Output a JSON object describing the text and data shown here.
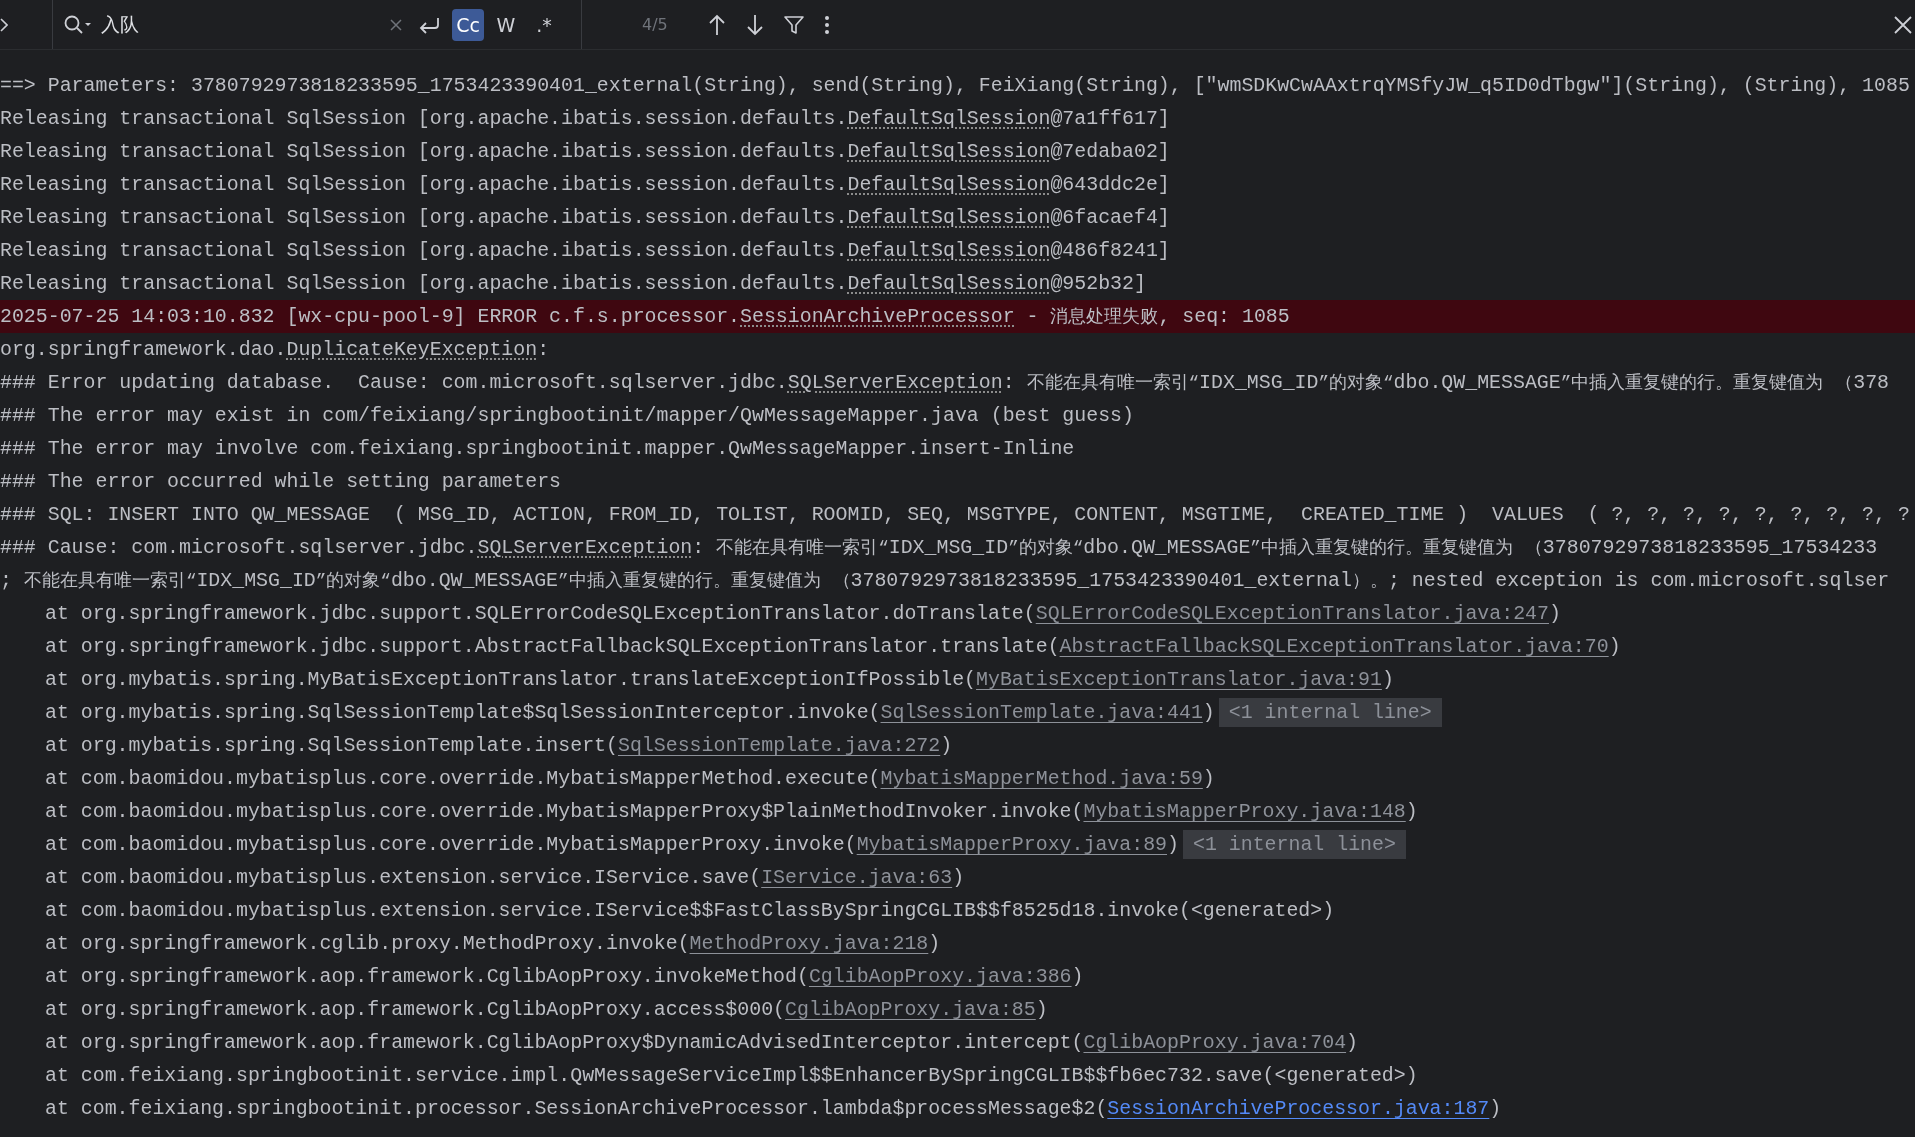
{
  "search": {
    "value": "入队",
    "options": [
      {
        "label": "Cc",
        "selected": true
      },
      {
        "label": "W",
        "selected": false
      },
      {
        "label": ".*",
        "selected": false
      }
    ],
    "match_count": "4/5"
  },
  "lines": [
    {
      "kind": "normal",
      "segments": [
        {
          "kind": "plain",
          "text": "==> Parameters: 3780792973818233595_1753423390401_external(String), send(String), FeiXiang(String), [\"wmSDKwCwAAxtrqYMSfyJW_q5ID0dTbgw\"](String), (String), 1085"
        }
      ]
    },
    {
      "kind": "normal",
      "segments": [
        {
          "kind": "plain",
          "text": "Releasing transactional SqlSession [org.apache.ibatis.session.defaults."
        },
        {
          "kind": "ref",
          "text": "DefaultSqlSession"
        },
        {
          "kind": "plain",
          "text": "@7a1ff617]"
        }
      ]
    },
    {
      "kind": "normal",
      "segments": [
        {
          "kind": "plain",
          "text": "Releasing transactional SqlSession [org.apache.ibatis.session.defaults."
        },
        {
          "kind": "ref",
          "text": "DefaultSqlSession"
        },
        {
          "kind": "plain",
          "text": "@7edaba02]"
        }
      ]
    },
    {
      "kind": "normal",
      "segments": [
        {
          "kind": "plain",
          "text": "Releasing transactional SqlSession [org.apache.ibatis.session.defaults."
        },
        {
          "kind": "ref",
          "text": "DefaultSqlSession"
        },
        {
          "kind": "plain",
          "text": "@643ddc2e]"
        }
      ]
    },
    {
      "kind": "normal",
      "segments": [
        {
          "kind": "plain",
          "text": "Releasing transactional SqlSession [org.apache.ibatis.session.defaults."
        },
        {
          "kind": "ref",
          "text": "DefaultSqlSession"
        },
        {
          "kind": "plain",
          "text": "@6facaef4]"
        }
      ]
    },
    {
      "kind": "normal",
      "segments": [
        {
          "kind": "plain",
          "text": "Releasing transactional SqlSession [org.apache.ibatis.session.defaults."
        },
        {
          "kind": "ref",
          "text": "DefaultSqlSession"
        },
        {
          "kind": "plain",
          "text": "@486f8241]"
        }
      ]
    },
    {
      "kind": "normal",
      "segments": [
        {
          "kind": "plain",
          "text": "Releasing transactional SqlSession [org.apache.ibatis.session.defaults."
        },
        {
          "kind": "ref",
          "text": "DefaultSqlSession"
        },
        {
          "kind": "plain",
          "text": "@952b32]"
        }
      ]
    },
    {
      "kind": "error",
      "segments": [
        {
          "kind": "plain",
          "text": "2025-07-25 14:03:10.832 [wx-cpu-pool-9] ERROR c.f.s.processor."
        },
        {
          "kind": "ref",
          "text": "SessionArchiveProcessor"
        },
        {
          "kind": "plain",
          "text": " - 消息处理失败, seq: 1085"
        }
      ]
    },
    {
      "kind": "normal",
      "segments": [
        {
          "kind": "plain",
          "text": "org.springframework.dao."
        },
        {
          "kind": "ref",
          "text": "DuplicateKeyException"
        },
        {
          "kind": "plain",
          "text": ":"
        }
      ]
    },
    {
      "kind": "normal",
      "segments": [
        {
          "kind": "plain",
          "text": "### Error updating database.  Cause: com.microsoft.sqlserver.jdbc."
        },
        {
          "kind": "ref",
          "text": "SQLServerException"
        },
        {
          "kind": "plain",
          "text": ": 不能在具有唯一索引“IDX_MSG_ID”的对象“dbo.QW_MESSAGE”中插入重复键的行。重复键值为 （378"
        }
      ]
    },
    {
      "kind": "normal",
      "segments": [
        {
          "kind": "plain",
          "text": "### The error may exist in com/feixiang/springbootinit/mapper/QwMessageMapper.java (best guess)"
        }
      ]
    },
    {
      "kind": "normal",
      "segments": [
        {
          "kind": "plain",
          "text": "### The error may involve com.feixiang.springbootinit.mapper.QwMessageMapper.insert-Inline"
        }
      ]
    },
    {
      "kind": "normal",
      "segments": [
        {
          "kind": "plain",
          "text": "### The error occurred while setting parameters"
        }
      ]
    },
    {
      "kind": "normal",
      "segments": [
        {
          "kind": "plain",
          "text": "### SQL: INSERT INTO QW_MESSAGE  ( MSG_ID, ACTION, FROM_ID, TOLIST, ROOMID, SEQ, MSGTYPE, CONTENT, MSGTIME,  CREATED_TIME )  VALUES  ( ?, ?, ?, ?, ?, ?, ?, ?, ?"
        }
      ]
    },
    {
      "kind": "normal",
      "segments": [
        {
          "kind": "plain",
          "text": "### Cause: com.microsoft.sqlserver.jdbc."
        },
        {
          "kind": "ref",
          "text": "SQLServerException"
        },
        {
          "kind": "plain",
          "text": ": 不能在具有唯一索引“IDX_MSG_ID”的对象“dbo.QW_MESSAGE”中插入重复键的行。重复键值为 （3780792973818233595_17534233"
        }
      ]
    },
    {
      "kind": "normal",
      "segments": [
        {
          "kind": "plain",
          "text": "; 不能在具有唯一索引“IDX_MSG_ID”的对象“dbo.QW_MESSAGE”中插入重复键的行。重复键值为 （3780792973818233595_1753423390401_external）。; nested exception is com.microsoft.sqlser"
        }
      ]
    },
    {
      "kind": "frame",
      "segments": [
        {
          "kind": "plain",
          "text": "at org.springframework.jdbc.support.SQLErrorCodeSQLExceptionTranslator.doTranslate("
        },
        {
          "kind": "link",
          "text": "SQLErrorCodeSQLExceptionTranslator.java:247"
        },
        {
          "kind": "plain",
          "text": ")"
        }
      ]
    },
    {
      "kind": "frame",
      "segments": [
        {
          "kind": "plain",
          "text": "at org.springframework.jdbc.support.AbstractFallbackSQLExceptionTranslator.translate("
        },
        {
          "kind": "link",
          "text": "AbstractFallbackSQLExceptionTranslator.java:70"
        },
        {
          "kind": "plain",
          "text": ")"
        }
      ]
    },
    {
      "kind": "frame",
      "segments": [
        {
          "kind": "plain",
          "text": "at org.mybatis.spring.MyBatisExceptionTranslator.translateExceptionIfPossible("
        },
        {
          "kind": "link",
          "text": "MyBatisExceptionTranslator.java:91"
        },
        {
          "kind": "plain",
          "text": ")"
        }
      ]
    },
    {
      "kind": "frame",
      "segments": [
        {
          "kind": "plain",
          "text": "at org.mybatis.spring.SqlSessionTemplate$SqlSessionInterceptor.invoke("
        },
        {
          "kind": "link",
          "text": "SqlSessionTemplate.java:441"
        },
        {
          "kind": "plain",
          "text": ")"
        },
        {
          "kind": "fold",
          "text": "<1 internal line>"
        }
      ]
    },
    {
      "kind": "frame",
      "segments": [
        {
          "kind": "plain",
          "text": "at org.mybatis.spring.SqlSessionTemplate.insert("
        },
        {
          "kind": "link",
          "text": "SqlSessionTemplate.java:272"
        },
        {
          "kind": "plain",
          "text": ")"
        }
      ]
    },
    {
      "kind": "frame",
      "segments": [
        {
          "kind": "plain",
          "text": "at com.baomidou.mybatisplus.core.override.MybatisMapperMethod.execute("
        },
        {
          "kind": "link",
          "text": "MybatisMapperMethod.java:59"
        },
        {
          "kind": "plain",
          "text": ")"
        }
      ]
    },
    {
      "kind": "frame",
      "segments": [
        {
          "kind": "plain",
          "text": "at com.baomidou.mybatisplus.core.override.MybatisMapperProxy$PlainMethodInvoker.invoke("
        },
        {
          "kind": "link",
          "text": "MybatisMapperProxy.java:148"
        },
        {
          "kind": "plain",
          "text": ")"
        }
      ]
    },
    {
      "kind": "frame",
      "segments": [
        {
          "kind": "plain",
          "text": "at com.baomidou.mybatisplus.core.override.MybatisMapperProxy.invoke("
        },
        {
          "kind": "link",
          "text": "MybatisMapperProxy.java:89"
        },
        {
          "kind": "plain",
          "text": ")"
        },
        {
          "kind": "fold",
          "text": "<1 internal line>"
        }
      ]
    },
    {
      "kind": "frame",
      "segments": [
        {
          "kind": "plain",
          "text": "at com.baomidou.mybatisplus.extension.service.IService.save("
        },
        {
          "kind": "link",
          "text": "IService.java:63"
        },
        {
          "kind": "plain",
          "text": ")"
        }
      ]
    },
    {
      "kind": "frame",
      "segments": [
        {
          "kind": "plain",
          "text": "at com.baomidou.mybatisplus.extension.service.IService$$FastClassBySpringCGLIB$$f8525d18.invoke(<generated>)"
        }
      ]
    },
    {
      "kind": "frame",
      "segments": [
        {
          "kind": "plain",
          "text": "at org.springframework.cglib.proxy.MethodProxy.invoke("
        },
        {
          "kind": "link",
          "text": "MethodProxy.java:218"
        },
        {
          "kind": "plain",
          "text": ")"
        }
      ]
    },
    {
      "kind": "frame",
      "segments": [
        {
          "kind": "plain",
          "text": "at org.springframework.aop.framework.CglibAopProxy.invokeMethod("
        },
        {
          "kind": "link",
          "text": "CglibAopProxy.java:386"
        },
        {
          "kind": "plain",
          "text": ")"
        }
      ]
    },
    {
      "kind": "frame",
      "segments": [
        {
          "kind": "plain",
          "text": "at org.springframework.aop.framework.CglibAopProxy.access$000("
        },
        {
          "kind": "link",
          "text": "CglibAopProxy.java:85"
        },
        {
          "kind": "plain",
          "text": ")"
        }
      ]
    },
    {
      "kind": "frame",
      "segments": [
        {
          "kind": "plain",
          "text": "at org.springframework.aop.framework.CglibAopProxy$DynamicAdvisedInterceptor.intercept("
        },
        {
          "kind": "link",
          "text": "CglibAopProxy.java:704"
        },
        {
          "kind": "plain",
          "text": ")"
        }
      ]
    },
    {
      "kind": "frame",
      "segments": [
        {
          "kind": "plain",
          "text": "at com.feixiang.springbootinit.service.impl.QwMessageServiceImpl$$EnhancerBySpringCGLIB$$fb6ec732.save(<generated>)"
        }
      ]
    },
    {
      "kind": "frame",
      "segments": [
        {
          "kind": "plain",
          "text": "at com.feixiang.springbootinit.processor.SessionArchiveProcessor.lambda$processMessage$2("
        },
        {
          "kind": "user-link",
          "text": "SessionArchiveProcessor.java:187"
        },
        {
          "kind": "plain",
          "text": ")"
        }
      ]
    }
  ]
}
